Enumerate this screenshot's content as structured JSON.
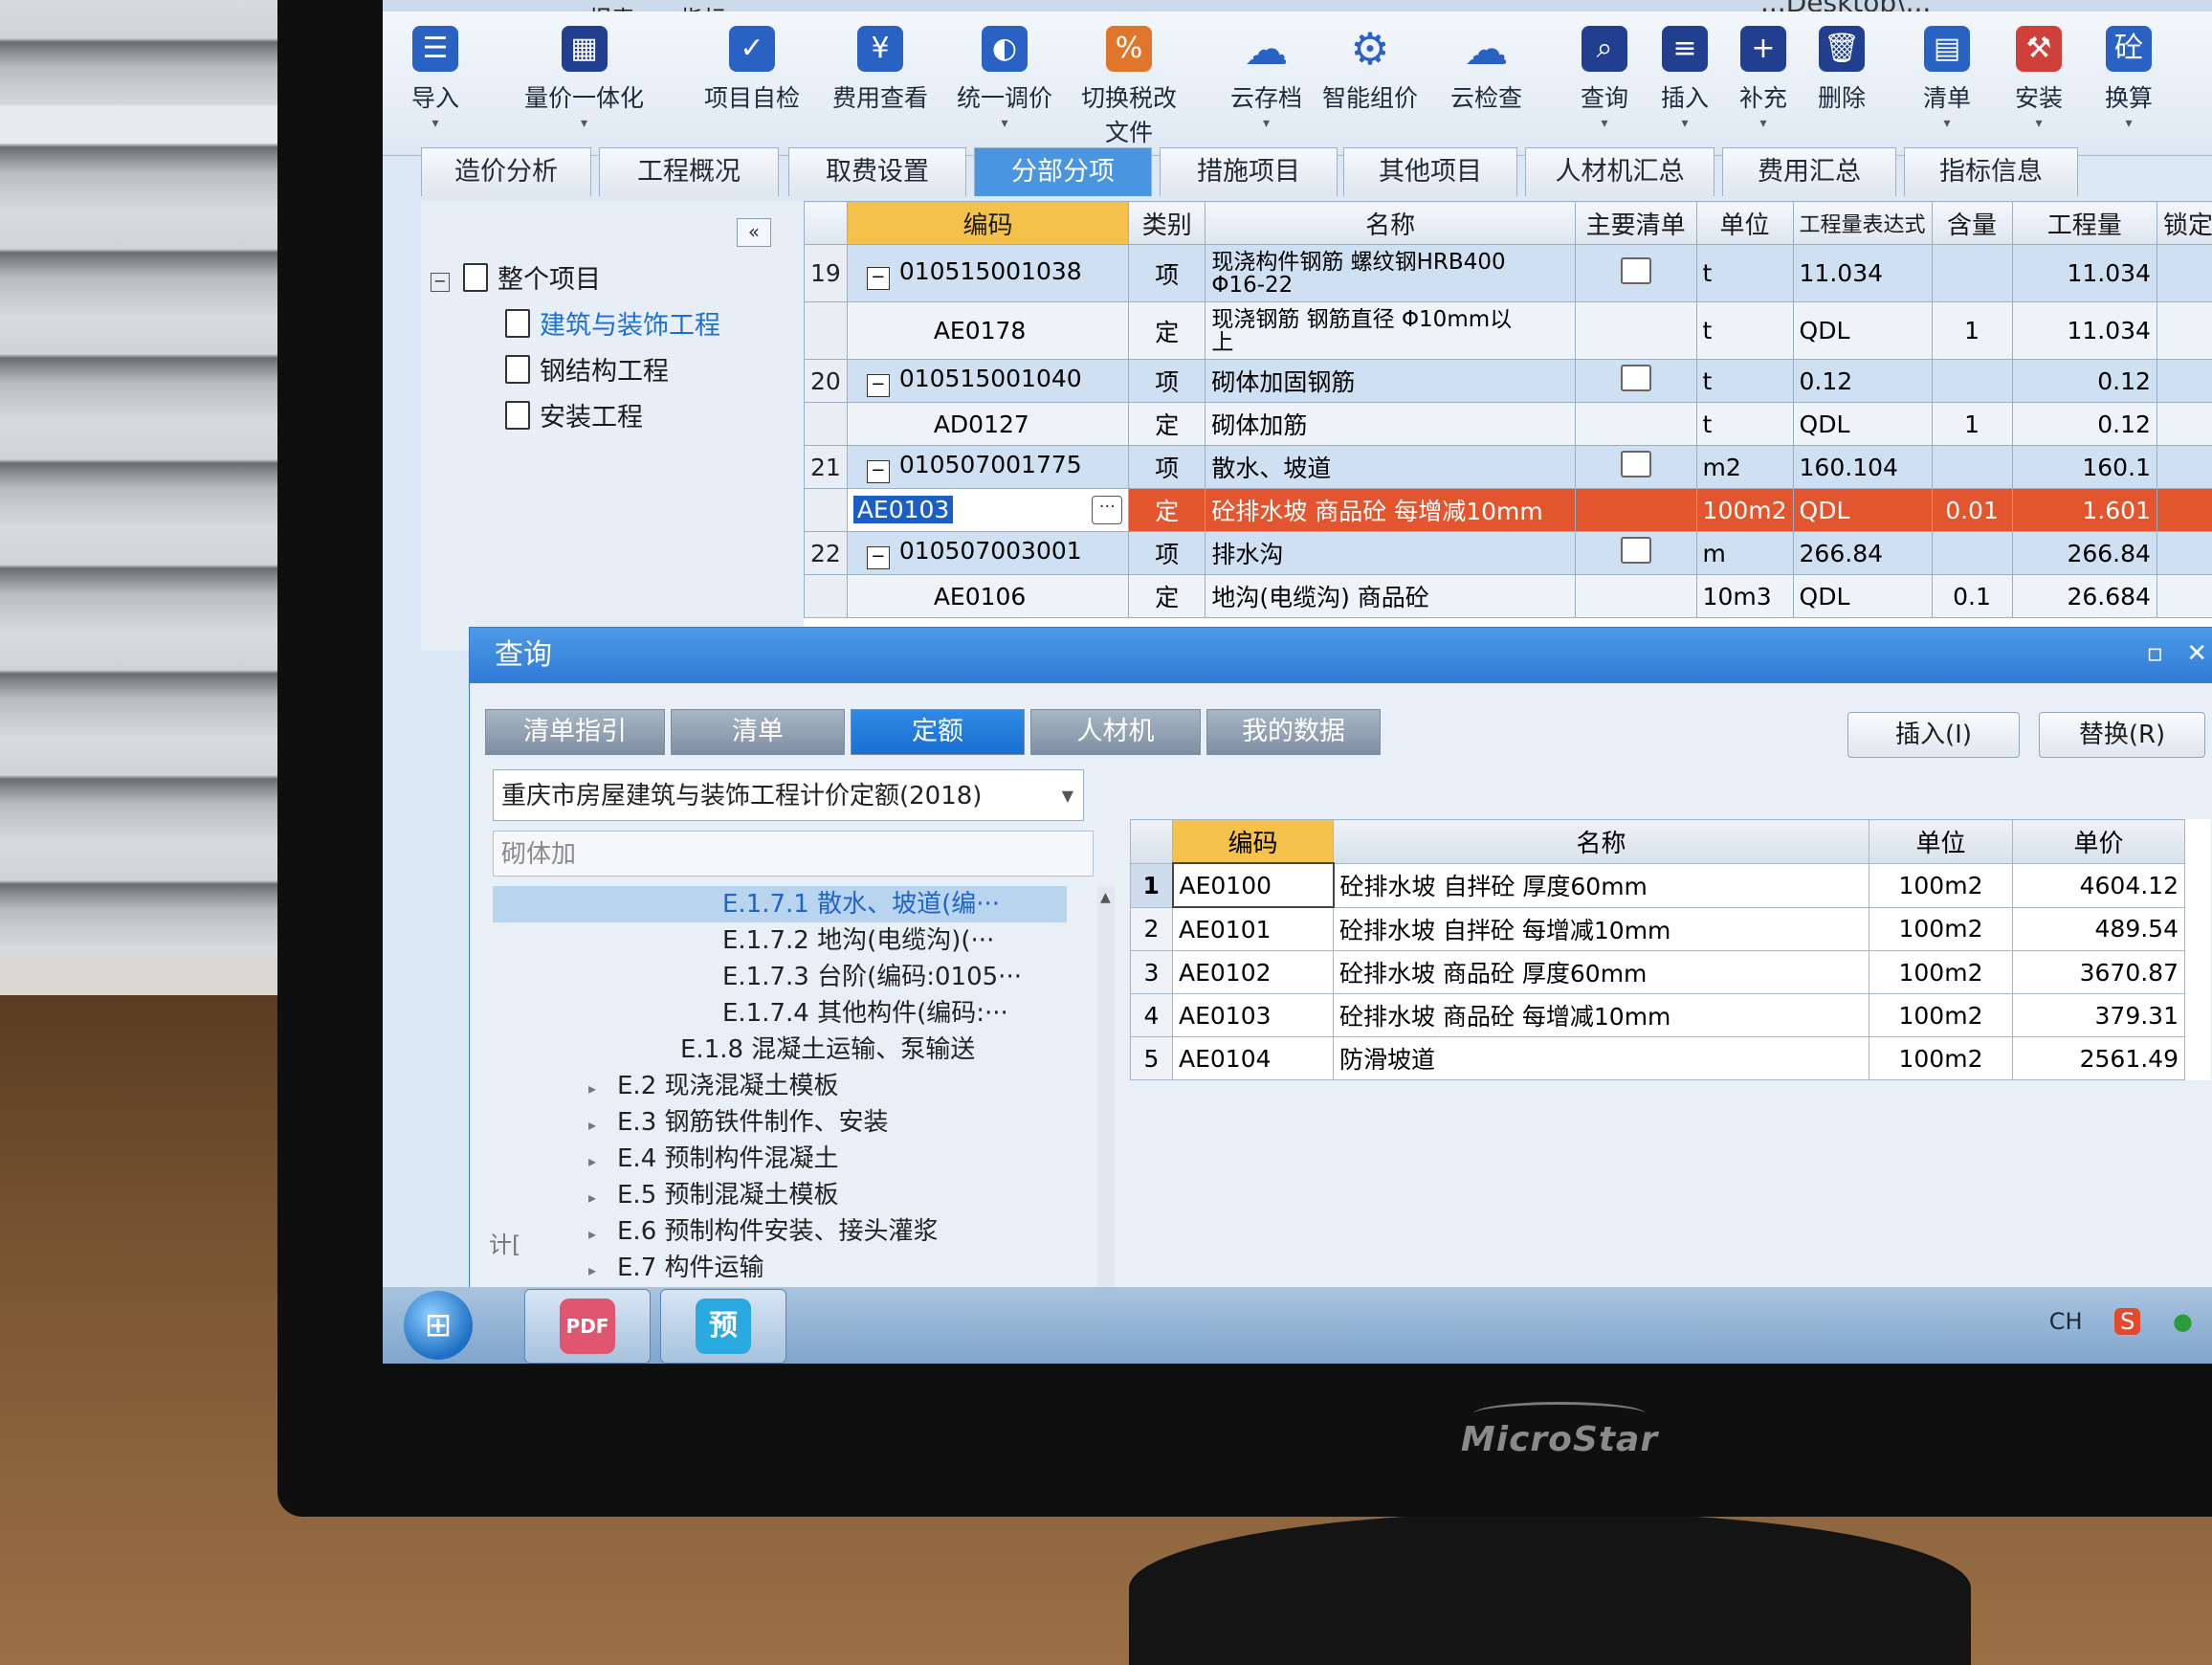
{
  "menu": [
    "",
    "",
    "报表",
    "指标"
  ],
  "window_title": "...Desktop\\...",
  "ribbon": [
    {
      "label": "导入",
      "icon": "import-icon"
    },
    {
      "label": "量价一体化",
      "icon": "qty-price-icon"
    },
    {
      "label": "项目自检",
      "icon": "self-check-icon"
    },
    {
      "label": "费用查看",
      "icon": "fee-view-icon"
    },
    {
      "label": "统一调价",
      "icon": "price-adjust-icon"
    },
    {
      "label": "切换税改",
      "label2": "文件",
      "icon": "tax-switch-icon"
    },
    {
      "label": "云存档",
      "icon": "cloud-save-icon"
    },
    {
      "label": "智能组价",
      "icon": "smart-price-icon"
    },
    {
      "label": "云检查",
      "icon": "cloud-check-icon"
    },
    {
      "label": "查询",
      "icon": "query-icon"
    },
    {
      "label": "插入",
      "icon": "insert-icon"
    },
    {
      "label": "补充",
      "icon": "supplement-icon"
    },
    {
      "label": "删除",
      "icon": "delete-icon"
    },
    {
      "label": "清单",
      "icon": "list-icon"
    },
    {
      "label": "安装",
      "icon": "install-icon"
    },
    {
      "label": "换算",
      "icon": "convert-icon"
    }
  ],
  "tabs": [
    "造价分析",
    "工程概况",
    "取费设置",
    "分部分项",
    "措施项目",
    "其他项目",
    "人材机汇总",
    "费用汇总",
    "指标信息"
  ],
  "active_tab": "分部分项",
  "tree": {
    "root": "整个项目",
    "children": [
      "建筑与装饰工程",
      "钢结构工程",
      "安装工程"
    ],
    "selected": "建筑与装饰工程"
  },
  "grid": {
    "headers": [
      "",
      "编码",
      "类别",
      "名称",
      "主要清单",
      "单位",
      "工程量表达式",
      "含量",
      "工程量",
      "锁定"
    ],
    "rows": [
      {
        "rn": "19",
        "code": "010515001038",
        "type": "项",
        "name": "现浇构件钢筋 螺纹钢HRB400",
        "name2": "Φ16-22",
        "unit": "t",
        "expr": "11.034",
        "content": "",
        "qty": "11.034",
        "kind": "item"
      },
      {
        "rn": "",
        "code": "AE0178",
        "type": "定",
        "name": "现浇钢筋 钢筋直径 Φ10mm以",
        "name2": "上",
        "unit": "t",
        "expr": "QDL",
        "content": "1",
        "qty": "11.034",
        "kind": "quota"
      },
      {
        "rn": "20",
        "code": "010515001040",
        "type": "项",
        "name": "砌体加固钢筋",
        "name2": "",
        "unit": "t",
        "expr": "0.12",
        "content": "",
        "qty": "0.12",
        "kind": "item"
      },
      {
        "rn": "",
        "code": "AD0127",
        "type": "定",
        "name": "砌体加筋",
        "name2": "",
        "unit": "t",
        "expr": "QDL",
        "content": "1",
        "qty": "0.12",
        "kind": "quota"
      },
      {
        "rn": "21",
        "code": "010507001775",
        "type": "项",
        "name": "散水、坡道",
        "name2": "",
        "unit": "m2",
        "expr": "160.104",
        "content": "",
        "qty": "160.1",
        "kind": "item"
      },
      {
        "rn": "",
        "code": "AE0103",
        "type": "定",
        "name": "砼排水坡 商品砼 每增减10mm",
        "name2": "",
        "unit": "100m2",
        "expr": "QDL",
        "content": "0.01",
        "qty": "1.601",
        "kind": "hl"
      },
      {
        "rn": "22",
        "code": "010507003001",
        "type": "项",
        "name": "排水沟",
        "name2": "",
        "unit": "m",
        "expr": "266.84",
        "content": "",
        "qty": "266.84",
        "kind": "item"
      },
      {
        "rn": "",
        "code": "AE0106",
        "type": "定",
        "name": "地沟(电缆沟) 商品砼",
        "name2": "",
        "unit": "10m3",
        "expr": "QDL",
        "content": "0.1",
        "qty": "26.684",
        "kind": "quota"
      }
    ]
  },
  "dialog": {
    "title": "查询",
    "tabs": [
      "清单指引",
      "清单",
      "定额",
      "人材机",
      "我的数据"
    ],
    "active_tab": "定额",
    "insert_button": "插入(I)",
    "replace_button": "替换(R)",
    "quota_library": "重庆市房屋建筑与装饰工程计价定额(2018)",
    "search_value": "砌体加",
    "tree": [
      {
        "label": "E.1.7.1 散水、坡道(编···",
        "level": 3,
        "selected": true
      },
      {
        "label": "E.1.7.2 地沟(电缆沟)(···",
        "level": 3
      },
      {
        "label": "E.1.7.3 台阶(编码:0105···",
        "level": 3
      },
      {
        "label": "E.1.7.4 其他构件(编码:···",
        "level": 3
      },
      {
        "label": "E.1.8 混凝土运输、泵输送",
        "level": 2
      },
      {
        "label": "E.2 现浇混凝土模板",
        "level": 1
      },
      {
        "label": "E.3 钢筋铁件制作、安装",
        "level": 1
      },
      {
        "label": "E.4 预制构件混凝土",
        "level": 1
      },
      {
        "label": "E.5 预制混凝土模板",
        "level": 1
      },
      {
        "label": "E.6 预制构件安装、接头灌浆",
        "level": 1
      },
      {
        "label": "E.7 构件运输",
        "level": 1
      }
    ],
    "result_headers": [
      "",
      "编码",
      "名称",
      "单位",
      "单价"
    ],
    "results": [
      {
        "rn": "1",
        "code": "AE0100",
        "name": "砼排水坡 自拌砼 厚度60mm",
        "unit": "100m2",
        "price": "4604.12"
      },
      {
        "rn": "2",
        "code": "AE0101",
        "name": "砼排水坡 自拌砼 每增减10mm",
        "unit": "100m2",
        "price": "489.54"
      },
      {
        "rn": "3",
        "code": "AE0102",
        "name": "砼排水坡 商品砼 厚度60mm",
        "unit": "100m2",
        "price": "3670.87"
      },
      {
        "rn": "4",
        "code": "AE0103",
        "name": "砼排水坡 商品砼 每增减10mm",
        "unit": "100m2",
        "price": "379.31"
      },
      {
        "rn": "5",
        "code": "AE0104",
        "name": "防滑坡道",
        "unit": "100m2",
        "price": "2561.49"
      }
    ],
    "status_fragment": "计["
  },
  "taskbar": {
    "apps": [
      {
        "label": "PDF",
        "icon": "pdf-app-icon"
      },
      {
        "label": "预",
        "icon": "budget-app-icon"
      }
    ],
    "tray_lang": "CH",
    "tray_ime": "S"
  },
  "monitor_brand": "MicroStar",
  "colors": {
    "accent": "#2f7bd5",
    "highlight_row": "#e2552e",
    "code_header": "#f4c24a"
  }
}
